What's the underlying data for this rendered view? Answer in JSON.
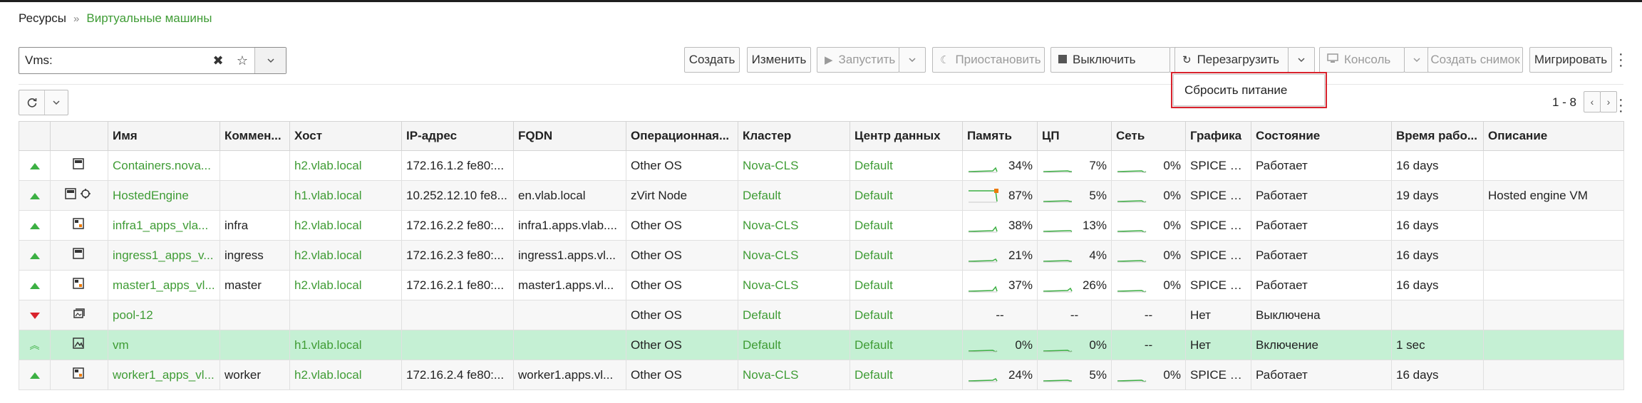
{
  "breadcrumb": {
    "root": "Ресурсы",
    "current": "Виртуальные машины"
  },
  "search": {
    "value": "Vms:"
  },
  "toolbar": {
    "create": "Создать",
    "edit": "Изменить",
    "run": "Запустить",
    "suspend": "Приостановить",
    "shutdown": "Выключить",
    "reboot": "Перезагрузить",
    "console": "Консоль",
    "snapshot": "Создать снимок",
    "migrate": "Мигрировать"
  },
  "reboot_menu": {
    "items": [
      "Сбросить питание"
    ]
  },
  "pager": {
    "range": "1 - 8"
  },
  "columns": [
    "",
    "",
    "Имя",
    "Коммен...",
    "Хост",
    "IP-адрес",
    "FQDN",
    "Операционная...",
    "Кластер",
    "Центр данных",
    "Память",
    "ЦП",
    "Сеть",
    "Графика",
    "Состояние",
    "Время рабо...",
    "Описание"
  ],
  "rows": [
    {
      "status": "up",
      "icons": "vm",
      "name": "Containers.nova...",
      "comment": "",
      "host": "h2.vlab.local",
      "ip": "172.16.1.2 fe80:...",
      "fqdn": "",
      "os": "Other OS",
      "cluster": "Nova-CLS",
      "dc": "Default",
      "mem": "34%",
      "cpu": "7%",
      "net": "0%",
      "graphics": "SPICE + ...",
      "state": "Работает",
      "uptime": "16 days",
      "desc": ""
    },
    {
      "status": "up",
      "icons": "vm-engine",
      "name": "HostedEngine",
      "comment": "",
      "host": "h1.vlab.local",
      "ip": "10.252.12.10 fe8...",
      "fqdn": "en.vlab.local",
      "os": "zVirt Node",
      "cluster": "Default",
      "dc": "Default",
      "mem": "87%",
      "cpu": "5%",
      "net": "0%",
      "graphics": "SPICE + ...",
      "state": "Работает",
      "uptime": "19 days",
      "desc": "Hosted engine VM"
    },
    {
      "status": "up",
      "icons": "vm-pool",
      "name": "infra1_apps_vla...",
      "comment": "infra",
      "host": "h2.vlab.local",
      "ip": "172.16.2.2 fe80:...",
      "fqdn": "infra1.apps.vlab....",
      "os": "Other OS",
      "cluster": "Nova-CLS",
      "dc": "Default",
      "mem": "38%",
      "cpu": "13%",
      "net": "0%",
      "graphics": "SPICE + ...",
      "state": "Работает",
      "uptime": "16 days",
      "desc": ""
    },
    {
      "status": "up",
      "icons": "vm",
      "name": "ingress1_apps_v...",
      "comment": "ingress",
      "host": "h2.vlab.local",
      "ip": "172.16.2.3 fe80:...",
      "fqdn": "ingress1.apps.vl...",
      "os": "Other OS",
      "cluster": "Nova-CLS",
      "dc": "Default",
      "mem": "21%",
      "cpu": "4%",
      "net": "0%",
      "graphics": "SPICE + ...",
      "state": "Работает",
      "uptime": "16 days",
      "desc": ""
    },
    {
      "status": "up",
      "icons": "vm-pool",
      "name": "master1_apps_vl...",
      "comment": "master",
      "host": "h2.vlab.local",
      "ip": "172.16.2.1 fe80:...",
      "fqdn": "master1.apps.vl...",
      "os": "Other OS",
      "cluster": "Nova-CLS",
      "dc": "Default",
      "mem": "37%",
      "cpu": "26%",
      "net": "0%",
      "graphics": "SPICE + ...",
      "state": "Работает",
      "uptime": "16 days",
      "desc": ""
    },
    {
      "status": "down",
      "icons": "pool",
      "name": "pool-12",
      "comment": "",
      "host": "",
      "ip": "",
      "fqdn": "",
      "os": "Other OS",
      "cluster": "Default",
      "dc": "Default",
      "mem": "--",
      "cpu": "--",
      "net": "--",
      "graphics": "Нет",
      "state": "Выключена",
      "uptime": "",
      "desc": ""
    },
    {
      "status": "wait",
      "icons": "image",
      "name": "vm",
      "comment": "",
      "host": "h1.vlab.local",
      "ip": "",
      "fqdn": "",
      "os": "Other OS",
      "cluster": "Default",
      "dc": "Default",
      "mem": "0%",
      "cpu": "0%",
      "net": "--",
      "graphics": "Нет",
      "state": "Включение",
      "uptime": "1 sec",
      "desc": ""
    },
    {
      "status": "up",
      "icons": "vm-pool",
      "name": "worker1_apps_vl...",
      "comment": "worker",
      "host": "h2.vlab.local",
      "ip": "172.16.2.4 fe80:...",
      "fqdn": "worker1.apps.vl...",
      "os": "Other OS",
      "cluster": "Nova-CLS",
      "dc": "Default",
      "mem": "24%",
      "cpu": "5%",
      "net": "0%",
      "graphics": "SPICE + ...",
      "state": "Работает",
      "uptime": "16 days",
      "desc": ""
    }
  ],
  "colors": {
    "accent": "#3f9c35",
    "selected_row": "#c5f0d4",
    "up": "#3cb043",
    "down": "#d9232d",
    "highlight": "#d9232d",
    "warn": "#ec7a08"
  }
}
